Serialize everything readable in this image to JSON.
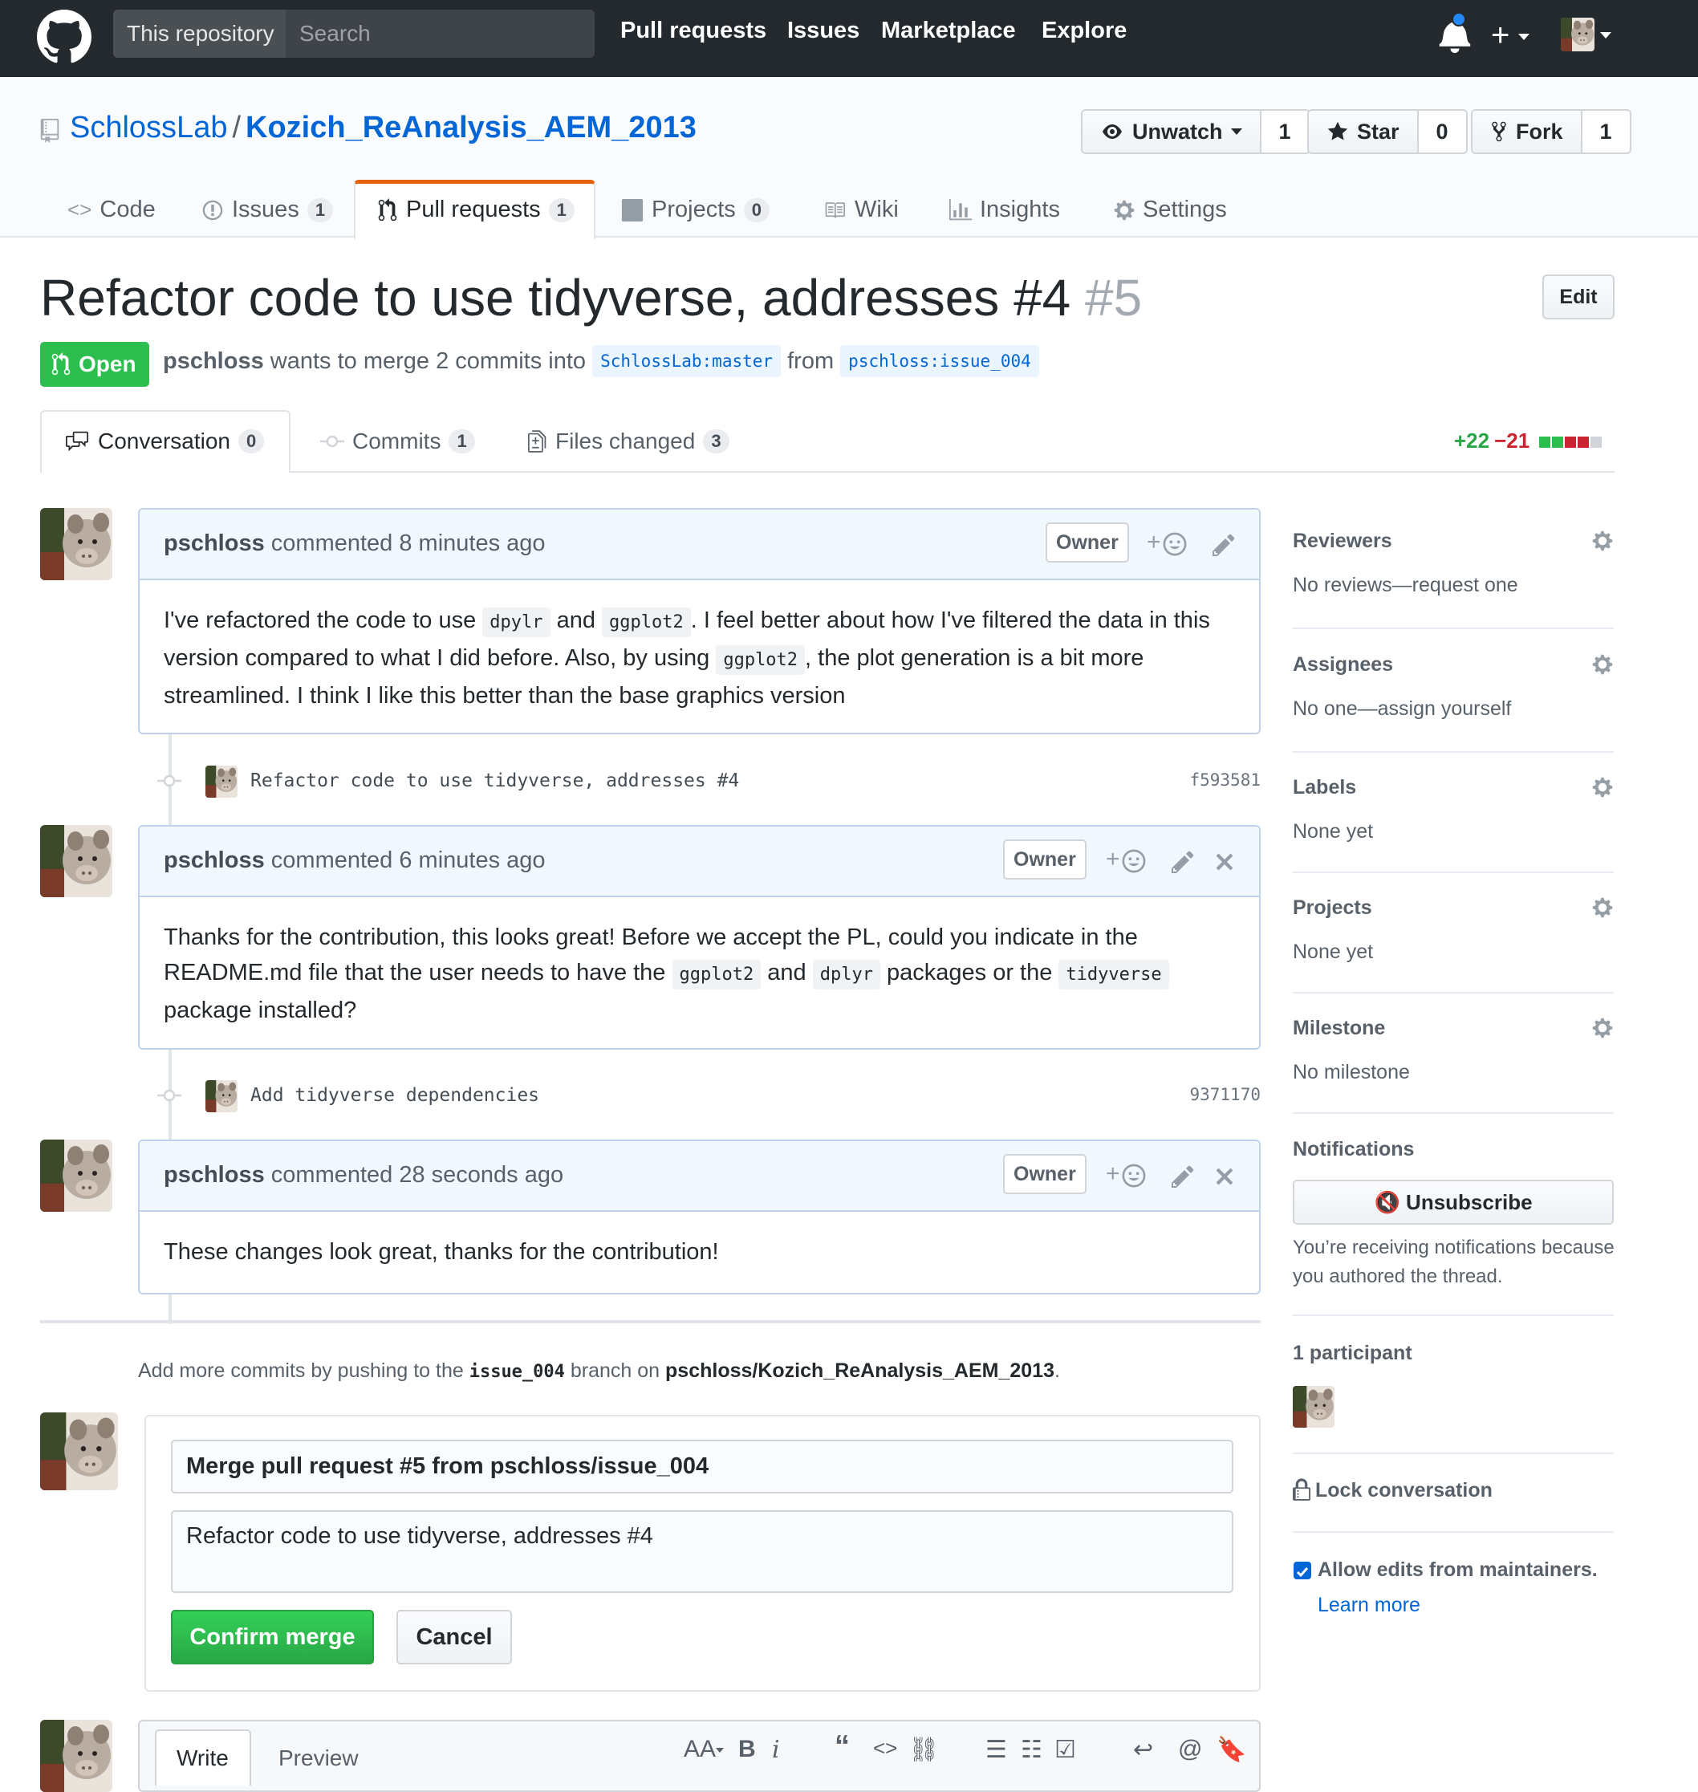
{
  "header": {
    "search_scope": "This repository",
    "search_placeholder": "Search",
    "nav": [
      "Pull requests",
      "Issues",
      "Marketplace",
      "Explore"
    ]
  },
  "repo": {
    "owner": "SchlossLab",
    "separator": "/",
    "name": "Kozich_ReAnalysis_AEM_2013",
    "unwatch_label": "Unwatch",
    "watch_count": "1",
    "star_label": "Star",
    "star_count": "0",
    "fork_label": "Fork",
    "fork_count": "1",
    "nav": {
      "code": "Code",
      "issues": "Issues",
      "issues_count": "1",
      "pulls": "Pull requests",
      "pulls_count": "1",
      "projects": "Projects",
      "projects_count": "0",
      "wiki": "Wiki",
      "insights": "Insights",
      "settings": "Settings"
    }
  },
  "pr": {
    "title": "Refactor code to use tidyverse, addresses #4",
    "number": "#5",
    "edit_label": "Edit",
    "state": "Open",
    "author": "pschloss",
    "meta_text": "wants to merge 2 commits into",
    "base_branch": "SchlossLab:master",
    "from_text": "from",
    "head_branch": "pschloss:issue_004",
    "tabs": {
      "conversation": "Conversation",
      "conversation_count": "0",
      "commits": "Commits",
      "commits_count": "1",
      "files": "Files changed",
      "files_count": "3"
    },
    "additions": "+22",
    "deletions": "−21"
  },
  "timeline": {
    "comments": [
      {
        "author": "pschloss",
        "time": "commented 8 minutes ago",
        "badge": "Owner",
        "body": [
          "I've refactored the code to use ",
          "dpylr",
          " and ",
          "ggplot2",
          ". I feel better about how I've filtered the data in this version compared to what I did before. Also, by using ",
          "ggplot2",
          ", the plot generation is a bit more streamlined. I think I like this better than the base graphics version"
        ]
      },
      {
        "author": "pschloss",
        "time": "commented 6 minutes ago",
        "badge": "Owner",
        "body": [
          "Thanks for the contribution, this looks great! Before we accept the PL, could you indicate in the README.md file that the user needs to have the ",
          "ggplot2",
          " and ",
          "dplyr",
          " packages or the ",
          "tidyverse",
          " package installed?"
        ]
      },
      {
        "author": "pschloss",
        "time": "commented 28 seconds ago",
        "badge": "Owner",
        "body": [
          "These changes look great, thanks for the contribution!"
        ]
      }
    ],
    "commits": [
      {
        "message": "Refactor code to use tidyverse, addresses #4",
        "sha": "f593581"
      },
      {
        "message": "Add tidyverse dependencies",
        "sha": "9371170"
      }
    ]
  },
  "merge": {
    "note_prefix": "Add more commits by pushing to the",
    "note_branch": "issue_004",
    "note_middle": "branch on",
    "note_repo": "pschloss/Kozich_ReAnalysis_AEM_2013",
    "note_end": ".",
    "commit_title": "Merge pull request #5 from pschloss/issue_004",
    "commit_message": "Refactor code to use tidyverse, addresses #4",
    "confirm_label": "Confirm merge",
    "cancel_label": "Cancel"
  },
  "editor": {
    "write_tab": "Write",
    "preview_tab": "Preview",
    "toolbar_icons": [
      "text-size-icon",
      "bold-icon",
      "italic-icon",
      "quote-icon",
      "code-icon",
      "link-icon",
      "unordered-list-icon",
      "ordered-list-icon",
      "task-list-icon",
      "reply-icon",
      "mention-icon",
      "bookmark-icon"
    ]
  },
  "sidebar": {
    "reviewers": {
      "heading": "Reviewers",
      "value": "No reviews—request one"
    },
    "assignees": {
      "heading": "Assignees",
      "value": "No one—assign yourself"
    },
    "labels": {
      "heading": "Labels",
      "value": "None yet"
    },
    "projects": {
      "heading": "Projects",
      "value": "None yet"
    },
    "milestone": {
      "heading": "Milestone",
      "value": "No milestone"
    },
    "notifications": {
      "heading": "Notifications",
      "button": "Unsubscribe",
      "reason": "You’re receiving notifications because you authored the thread."
    },
    "participants": {
      "heading": "1 participant"
    },
    "lock": "Lock conversation",
    "allow_edits": "Allow edits from maintainers.",
    "allow_edits_checked": true,
    "learn_more": "Learn more"
  },
  "colors": {
    "header_bg": "#24292e",
    "link": "#0366d6",
    "open_green": "#2cbe4e",
    "tab_accent": "#e36209",
    "comment_border": "#c0d3eb",
    "comment_head_bg": "#f1f8ff"
  }
}
